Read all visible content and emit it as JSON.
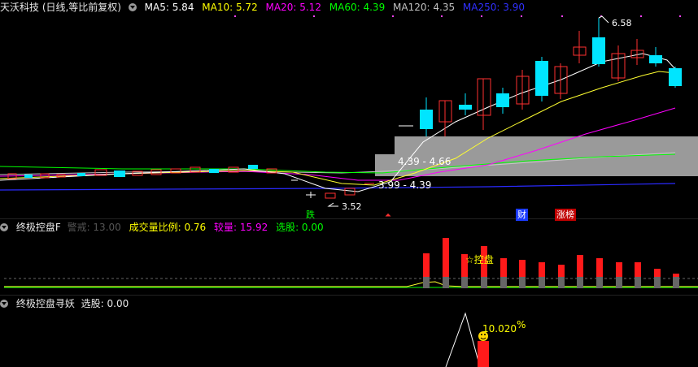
{
  "main": {
    "title": "天沃科技 (日线,等比前复权)",
    "ma": [
      {
        "label": "MA5:",
        "value": "5.84",
        "color": "#ffffff"
      },
      {
        "label": "MA10:",
        "value": "5.72",
        "color": "#ffff00"
      },
      {
        "label": "MA20:",
        "value": "5.12",
        "color": "#ff00ff"
      },
      {
        "label": "MA60:",
        "value": "4.39",
        "color": "#00ff00"
      },
      {
        "label": "MA120:",
        "value": "4.35",
        "color": "#c0c0c0"
      },
      {
        "label": "MA250:",
        "value": "3.90",
        "color": "#3030ff"
      }
    ],
    "high_label": "6.58",
    "low_label": "3.52",
    "zone1": "4.39 - 4.66",
    "zone2": "3.99 - 4.39",
    "tag_die": "跌",
    "tag_cai": "财",
    "tag_zhangbang": "涨榜"
  },
  "panel2": {
    "title": "终极控盘F",
    "warn_label": "警戒: 13.00",
    "vol_ratio_label": "成交量比例: 0.76",
    "vol_label": "较量: 15.92",
    "pick_label": "选股: 0.00",
    "annotation": "☆控盘"
  },
  "panel3": {
    "title": "终极控盘寻妖",
    "pick_label": "选股: 0.00",
    "pct_label": "10.020",
    "pct_sign": "%"
  },
  "colors": {
    "up": "#ff3030",
    "down": "#00e5ff",
    "bg": "#000000"
  }
}
